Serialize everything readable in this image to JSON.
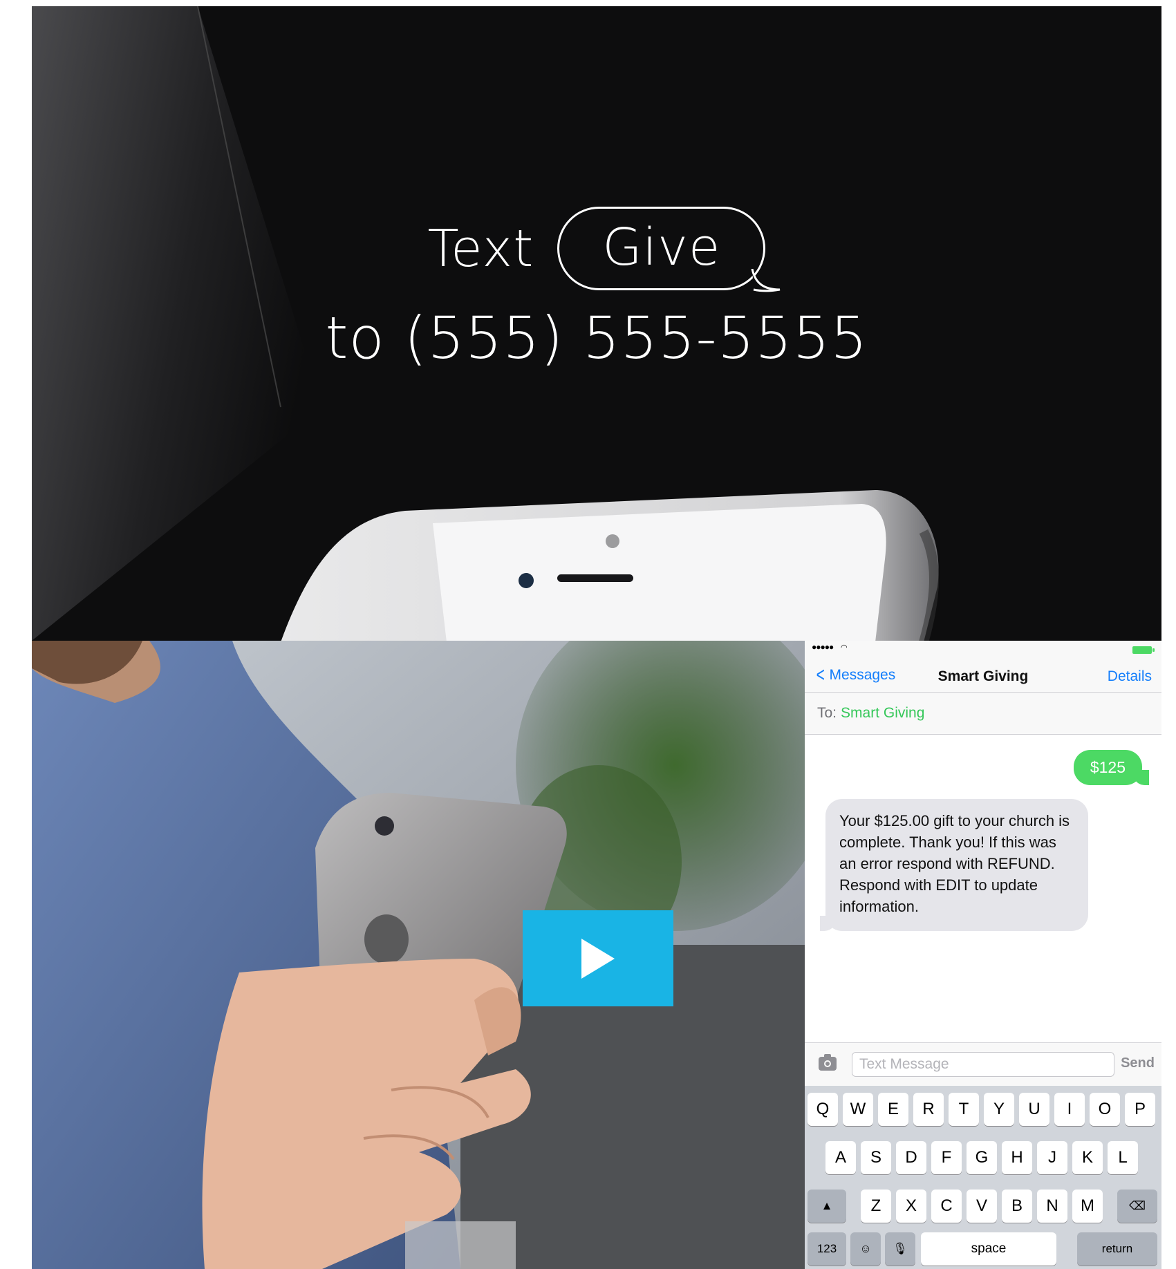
{
  "hero": {
    "text_word": "Text",
    "keyword": "Give",
    "phone_line": "to (555) 555-5555"
  },
  "video": {
    "play_icon": "play-icon",
    "play_color": "#19b4e5"
  },
  "messages": {
    "back_label": "Messages",
    "title": "Smart Giving",
    "details_label": "Details",
    "to_label": "To:",
    "to_value": "Smart Giving",
    "sent_message": "$125",
    "received_message": "Your $125.00 gift to your church is complete. Thank you! If this was an error respond with REFUND. Respond with EDIT to update information.",
    "input_placeholder": "Text Message",
    "send_label": "Send",
    "colors": {
      "accent": "#147efb",
      "sent_bubble": "#4cd964",
      "received_bubble": "#e5e5ea"
    }
  },
  "keyboard": {
    "row1": [
      "Q",
      "W",
      "E",
      "R",
      "T",
      "Y",
      "U",
      "I",
      "O",
      "P"
    ],
    "row2": [
      "A",
      "S",
      "D",
      "F",
      "G",
      "H",
      "J",
      "K",
      "L"
    ],
    "row3": [
      "Z",
      "X",
      "C",
      "V",
      "B",
      "N",
      "M"
    ],
    "shift_icon": "shift-icon",
    "delete_icon": "delete-icon",
    "numbers_label": "123",
    "emoji_icon": "emoji-icon",
    "mic_icon": "microphone-icon",
    "space_label": "space",
    "return_label": "return"
  }
}
